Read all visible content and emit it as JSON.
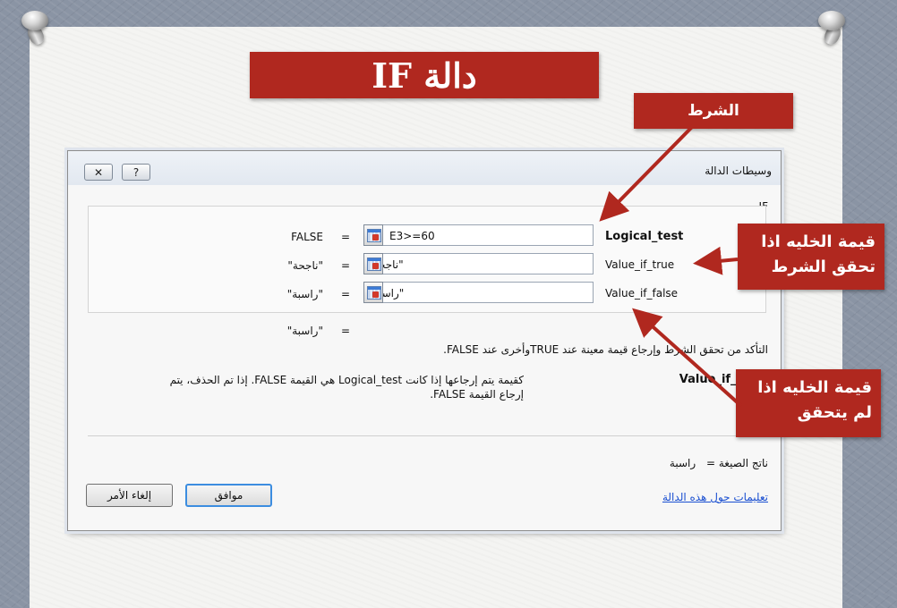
{
  "slide": {
    "title": "دالة IF"
  },
  "callouts": {
    "condition": "الشرط",
    "true_value_line1": "قيمة الخليه اذا",
    "true_value_line2": "تحقق الشرط",
    "false_value_line1": "قيمة الخليه اذا",
    "false_value_line2": "لم يتحقق"
  },
  "dialog": {
    "title": "وسيطات الدالة",
    "close_glyph": "✕",
    "help_glyph": "?",
    "function_name": "IF",
    "arguments": [
      {
        "label": "Logical_test",
        "value": "E3>=60",
        "result": "FALSE"
      },
      {
        "label": "Value_if_true",
        "value": "\"ناجحة\"",
        "result": "\"ناجحة\""
      },
      {
        "label": "Value_if_false",
        "value": "\"راسبة\"",
        "result": "\"راسبة\""
      }
    ],
    "equals": "=",
    "formula_result_preview": "\"راسبة\"",
    "description": "التأكد من تحقق الشرط وإرجاع قيمة معينة عند TRUEوأخرى عند FALSE.",
    "arg_help_name": "Value_if_false",
    "arg_help_text_line1": "كقيمة يتم إرجاعها إذا كانت Logical_test هي القيمة FALSE. إذا تم الحذف، يتم",
    "arg_help_text_line2": "إرجاع القيمة FALSE.",
    "formula_result_label": "ناتج الصيغة =",
    "formula_result_value": "راسبة",
    "help_link": "تعليمات حول هذه الدالة",
    "ok_label": "موافق",
    "cancel_label": "إلغاء الأمر"
  },
  "colors": {
    "accent_red": "#b0281f",
    "link_blue": "#1a4fd1"
  }
}
